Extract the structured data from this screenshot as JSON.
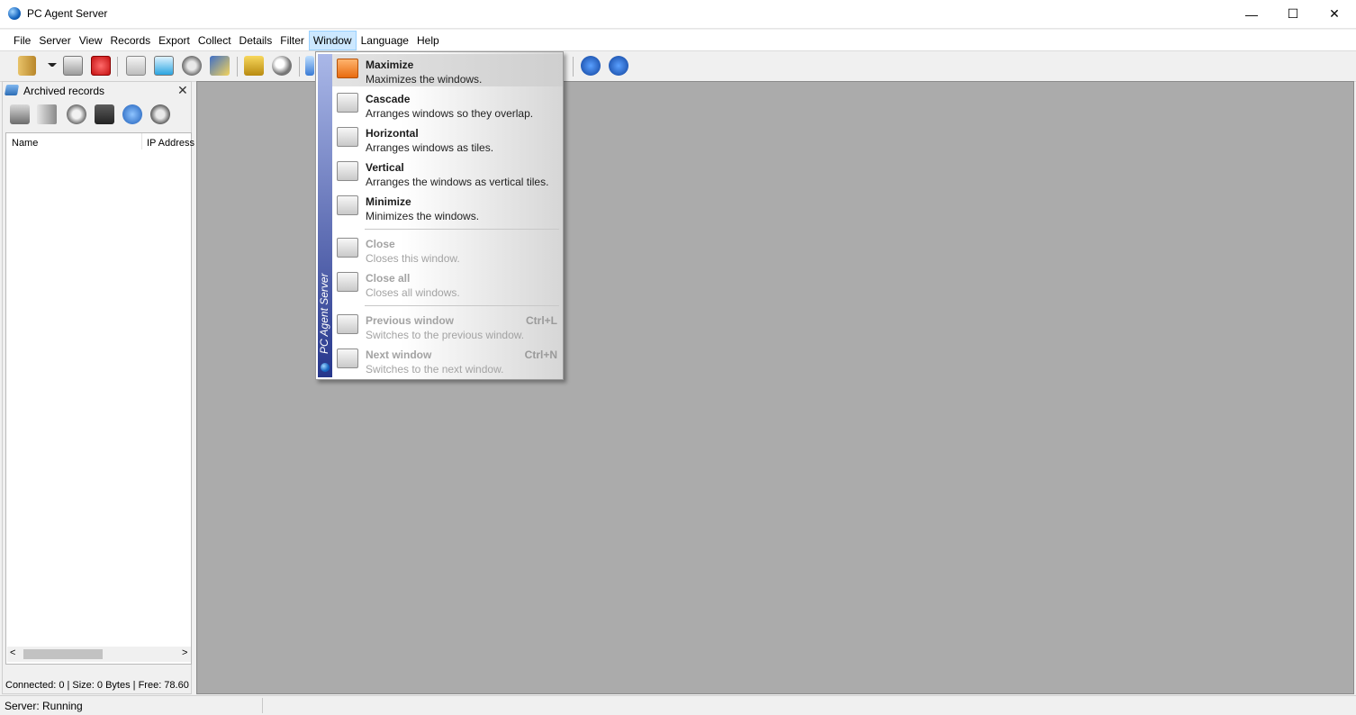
{
  "window": {
    "title": "PC Agent Server",
    "minimize": "—",
    "maximize": "☐",
    "close": "✕"
  },
  "menu": [
    "File",
    "Server",
    "View",
    "Records",
    "Export",
    "Collect",
    "Details",
    "Filter",
    "Window",
    "Language",
    "Help"
  ],
  "active_menu": "Window",
  "left_pane": {
    "title": "Archived records",
    "close": "✕",
    "columns": [
      "Name",
      "IP Address"
    ],
    "scroll_left": "<",
    "scroll_right": ">",
    "status": "Connected: 0 | Size: 0 Bytes | Free: 78.60"
  },
  "statusbar": {
    "text": "Server: Running"
  },
  "dropdown": {
    "strip_label": "PC Agent Server",
    "items": [
      {
        "title": "Maximize",
        "desc": "Maximizes the windows.",
        "enabled": true,
        "highlighted": true
      },
      {
        "title": "Cascade",
        "desc": "Arranges windows so they overlap.",
        "enabled": true
      },
      {
        "title": "Horizontal",
        "desc": "Arranges windows as tiles.",
        "enabled": true
      },
      {
        "title": "Vertical",
        "desc": "Arranges the windows as vertical tiles.",
        "enabled": true
      },
      {
        "title": "Minimize",
        "desc": "Minimizes the windows.",
        "enabled": true
      },
      {
        "title": "Close",
        "desc": "Closes this window.",
        "enabled": false
      },
      {
        "title": "Close all",
        "desc": "Closes all windows.",
        "enabled": false
      },
      {
        "title": "Previous window",
        "desc": "Switches to the previous window.",
        "shortcut": "Ctrl+L",
        "enabled": false
      },
      {
        "title": "Next window",
        "desc": "Switches to the next window.",
        "shortcut": "Ctrl+N",
        "enabled": false
      }
    ]
  },
  "toolbar_icons": [
    "open-folder-icon",
    "dropdown-arrow-icon",
    "server-icon",
    "power-icon",
    "play-icon",
    "window-icon",
    "gear-icon",
    "edit-icon",
    "lock-icon",
    "search-icon",
    "monitor-icon",
    "help-icon",
    "info-icon"
  ],
  "colors": {
    "workspace": "#ababab",
    "menu_active": "#cce8ff",
    "strip": "#26368c",
    "highlight_icon": "#e86b10"
  }
}
